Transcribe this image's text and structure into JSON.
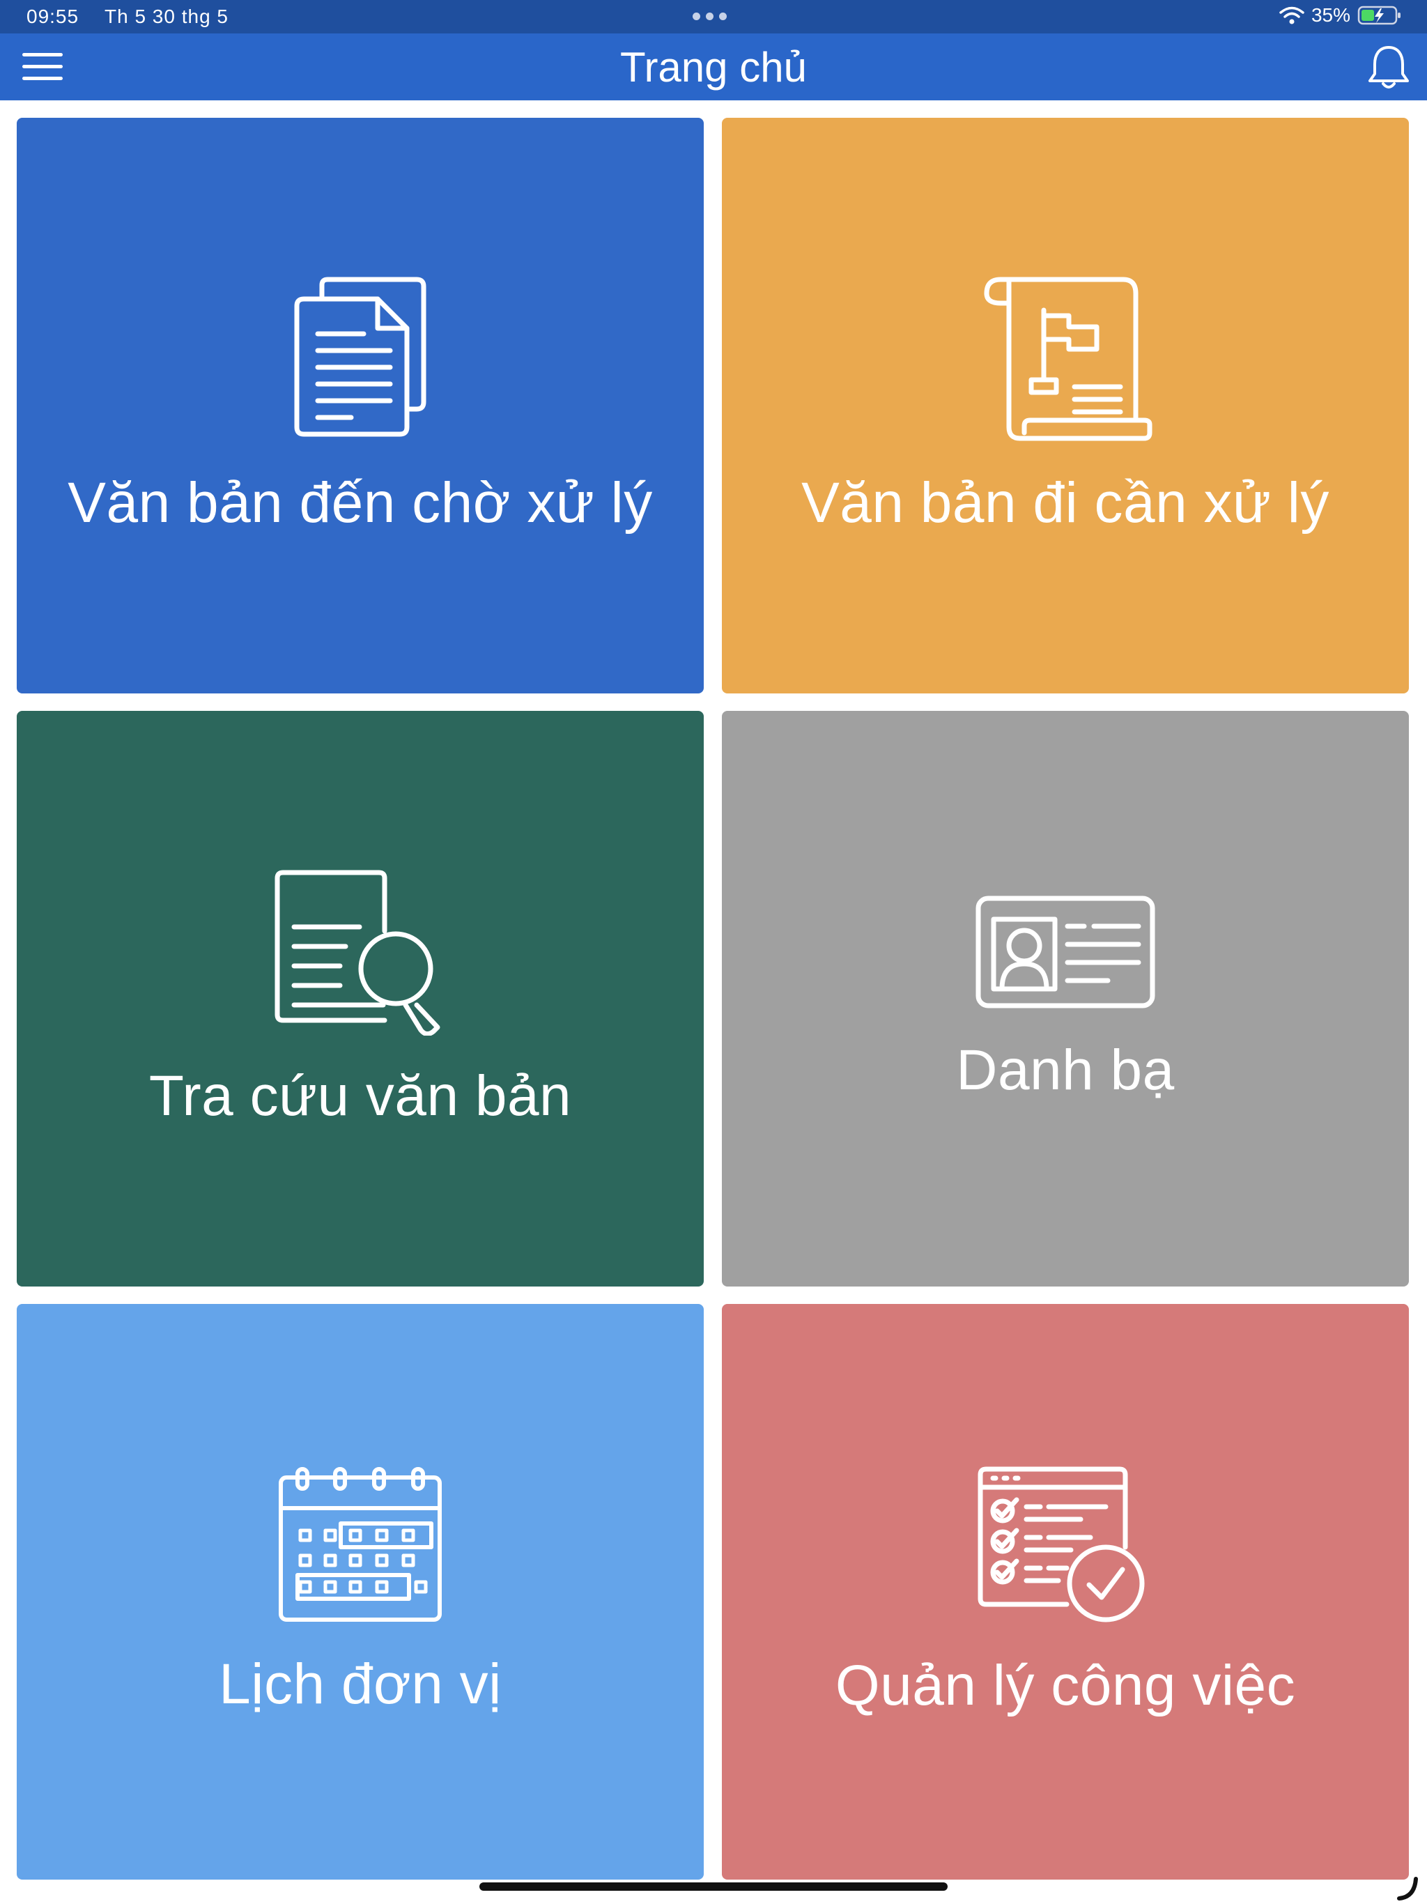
{
  "status_bar": {
    "time": "09:55",
    "date": "Th 5 30 thg 5",
    "battery": "35%",
    "icons": [
      "wifi-icon",
      "battery-charging-icon"
    ]
  },
  "header": {
    "title": "Trang chủ",
    "left_icon": "menu-icon",
    "right_icon": "bell-icon"
  },
  "tiles": [
    {
      "label": "Văn bản đến chờ xử lý",
      "icon": "documents-icon",
      "color": "#3169c7"
    },
    {
      "label": "Văn bản đi cần xử lý",
      "icon": "scroll-flag-icon",
      "color": "#eaa94f"
    },
    {
      "label": "Tra cứu văn bản",
      "icon": "document-search-icon",
      "color": "#2c675c"
    },
    {
      "label": "Danh bạ",
      "icon": "contact-card-icon",
      "color": "#a0a0a0"
    },
    {
      "label": "Lịch đơn vị",
      "icon": "calendar-icon",
      "color": "#64a4ea"
    },
    {
      "label": "Quản lý công việc",
      "icon": "task-checklist-icon",
      "color": "#d57a79"
    }
  ]
}
